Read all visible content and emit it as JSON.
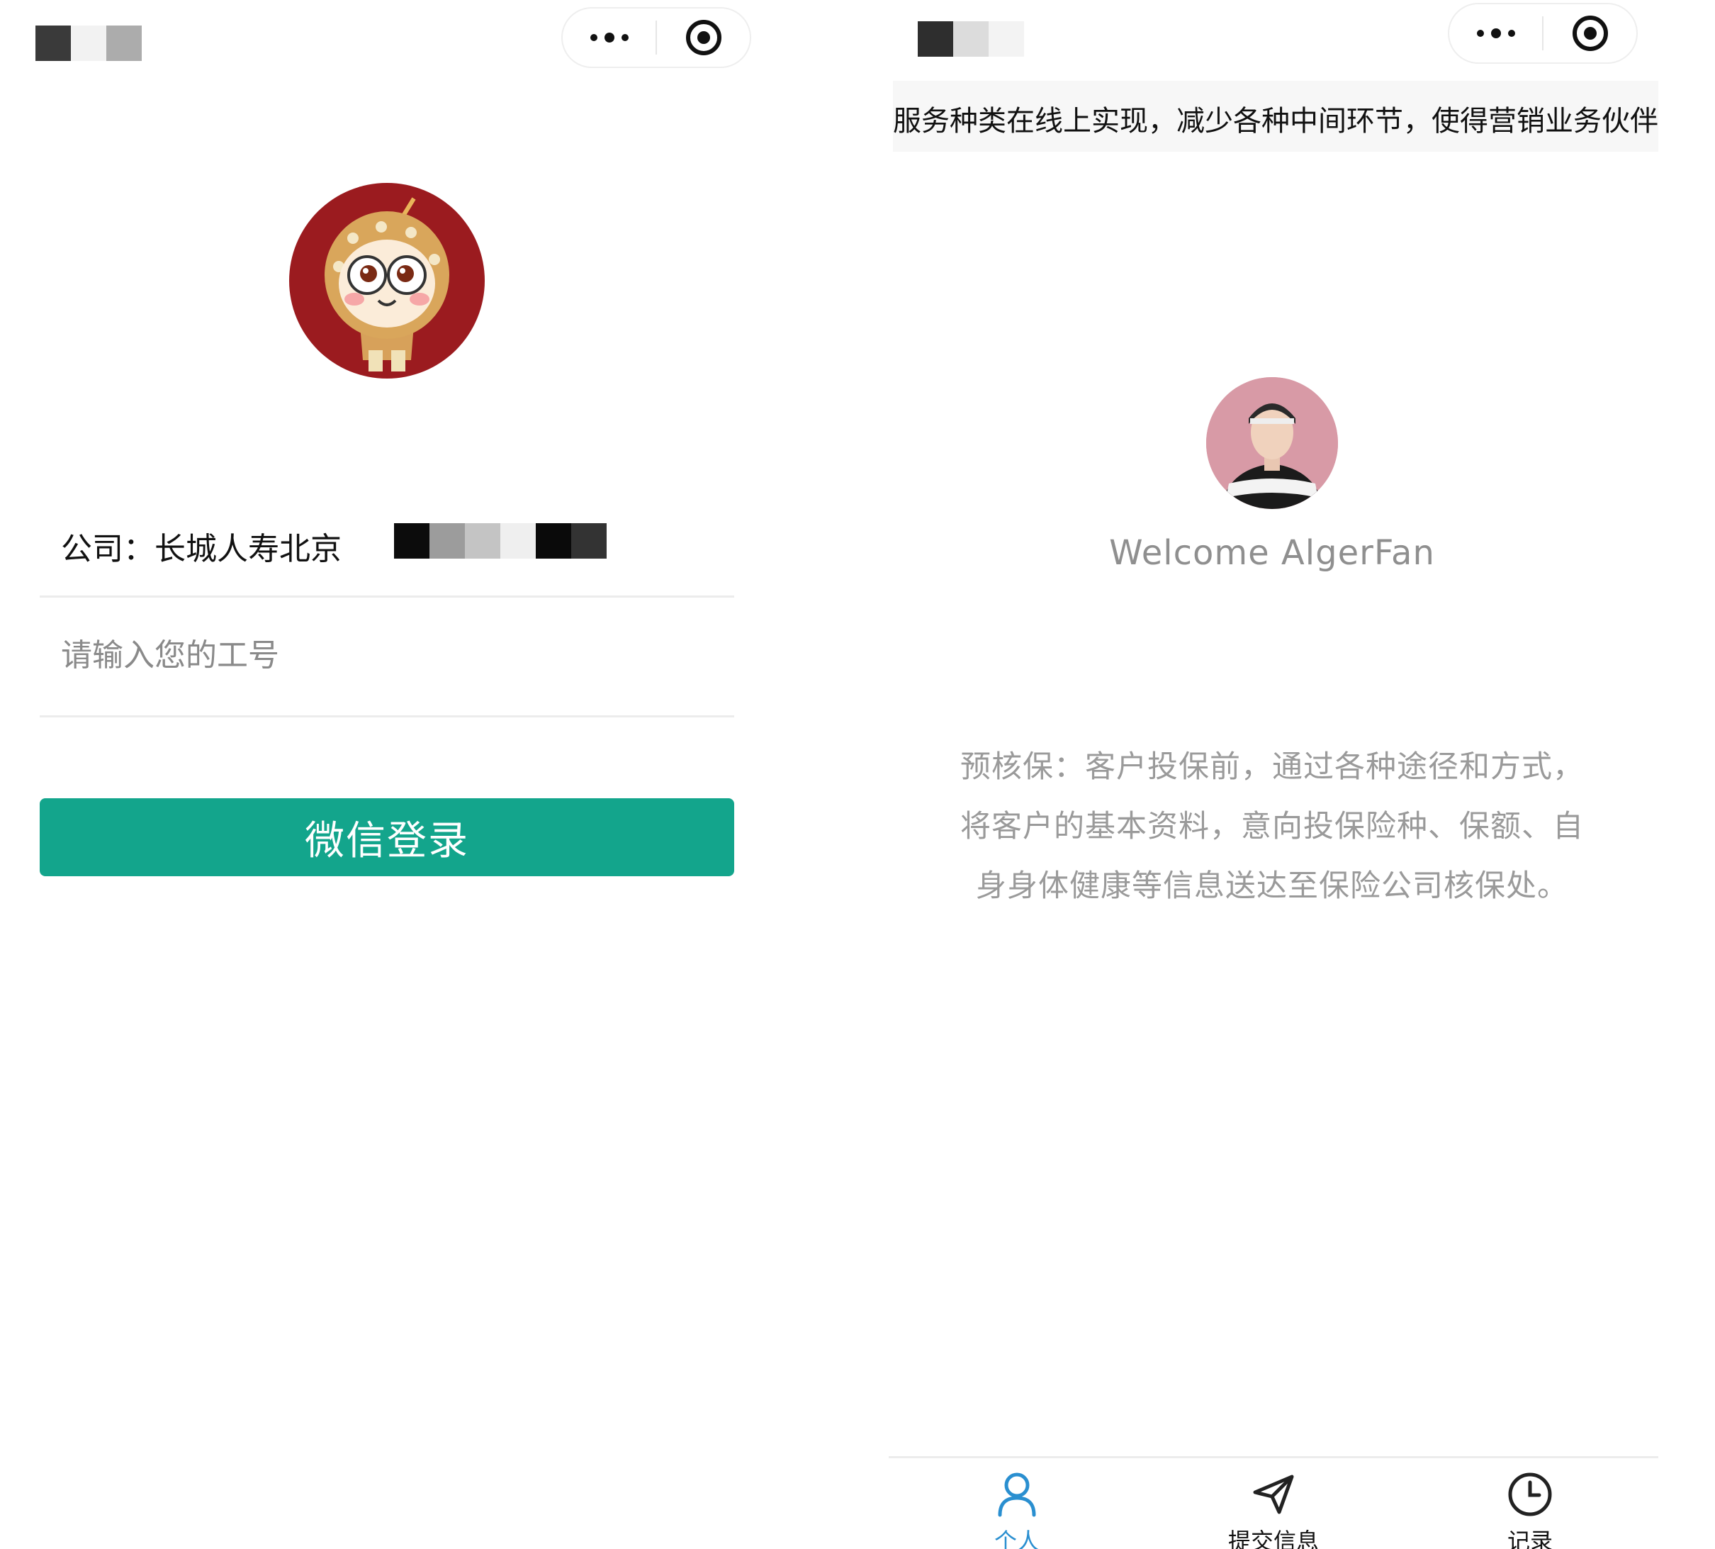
{
  "login_screen": {
    "capsule": {
      "menu_icon": "more-dots-icon",
      "close_icon": "target-close-icon"
    },
    "company_label": "公司：长城人寿北京",
    "employee_id": {
      "value": "",
      "placeholder": "请输入您的工号"
    },
    "login_button_label": "微信登录"
  },
  "home_screen": {
    "capsule": {
      "menu_icon": "more-dots-icon",
      "close_icon": "target-close-icon"
    },
    "notice_text": "服务种类在线上实现，减少各种中间环节，使得营销业务伙伴将",
    "welcome_text": "Welcome AlgerFan",
    "description": "预核保：客户投保前，通过各种途径和方式，将客户的基本资料，意向投保险种、保额、自身身体健康等信息送达至保险公司核保处。",
    "tabs": [
      {
        "label": "个人",
        "icon": "person-icon",
        "active": true
      },
      {
        "label": "提交信息",
        "icon": "send-icon",
        "active": false
      },
      {
        "label": "记录",
        "icon": "clock-icon",
        "active": false
      }
    ]
  },
  "colors": {
    "primary_button": "#13a58c",
    "active_tab": "#2a8fd0",
    "logo_background": "#9b1b1f",
    "muted_text": "#9a9a9a"
  }
}
